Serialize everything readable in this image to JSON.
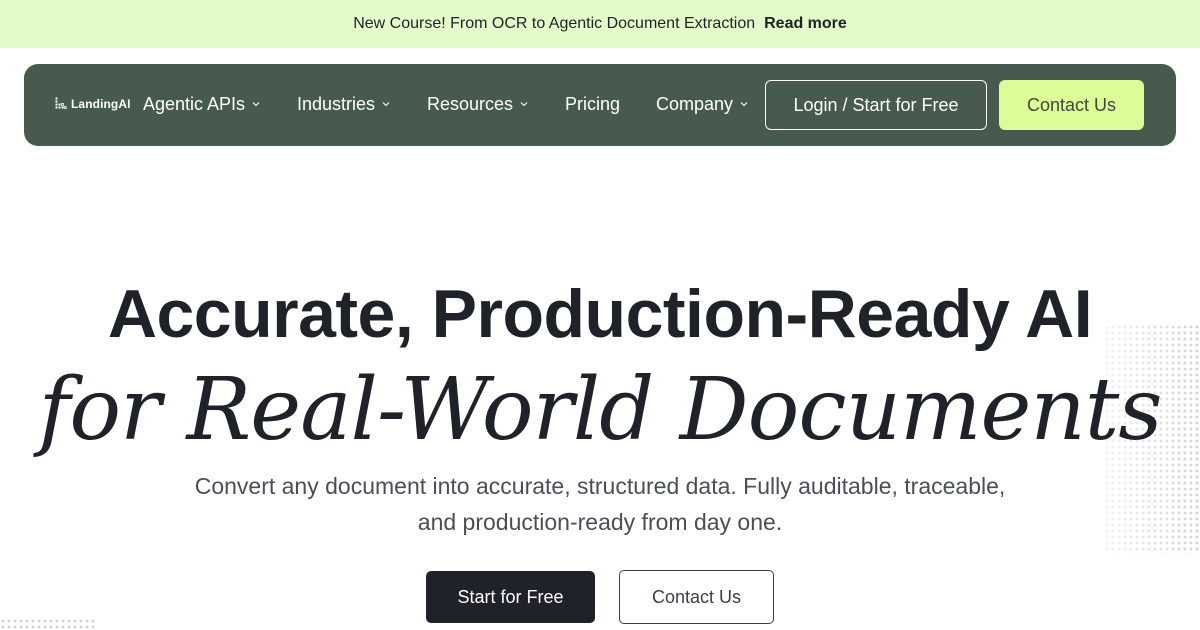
{
  "announcement": {
    "text": "New Course! From OCR to Agentic Document Extraction",
    "link": "Read more"
  },
  "nav": {
    "logo_text": "LandingAI",
    "logo_icon": "landingai-logo-icon",
    "items": [
      {
        "label": "Agentic APIs",
        "has_dropdown": true
      },
      {
        "label": "Industries",
        "has_dropdown": true
      },
      {
        "label": "Resources",
        "has_dropdown": true
      },
      {
        "label": "Pricing",
        "has_dropdown": false
      },
      {
        "label": "Company",
        "has_dropdown": true
      }
    ],
    "login_label": "Login / Start for Free",
    "contact_label": "Contact Us"
  },
  "hero": {
    "title_line1": "Accurate, Production-Ready AI",
    "title_line2": "for Real-World Documents",
    "subtitle_line1": "Convert any document into accurate, structured data. Fully auditable, traceable,",
    "subtitle_line2": "and production-ready from day one.",
    "primary_cta": "Start for Free",
    "secondary_cta": "Contact Us"
  },
  "colors": {
    "announcement_bg": "#e2fbc8",
    "navbar_bg": "#465a4d",
    "accent": "#dcfc97",
    "primary_button": "#1f2329",
    "text": "#1f2329"
  }
}
